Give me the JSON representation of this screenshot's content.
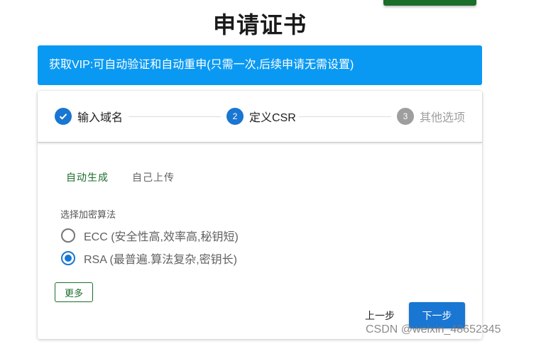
{
  "page": {
    "title": "申请证书"
  },
  "banner": {
    "text": "获取VIP:可自动验证和自动重申(只需一次,后续申请无需设置)"
  },
  "stepper": {
    "steps": [
      {
        "number": "",
        "label": "输入域名",
        "state": "done"
      },
      {
        "number": "2",
        "label": "定义CSR",
        "state": "active"
      },
      {
        "number": "3",
        "label": "其他选项",
        "state": "pending"
      }
    ]
  },
  "csr": {
    "tabs": [
      {
        "label": "自动生成",
        "selected": true
      },
      {
        "label": "自己上传",
        "selected": false
      }
    ],
    "algorithm_label": "选择加密算法",
    "options": [
      {
        "label": "ECC (安全性高,效率高,秘钥短)",
        "checked": false
      },
      {
        "label": "RSA (最普遍.算法复杂,密钥长)",
        "checked": true
      }
    ],
    "more_label": "更多"
  },
  "actions": {
    "prev_label": "上一步",
    "next_label": "下一步"
  },
  "watermark": {
    "text": "CSDN @weixin_48652345"
  },
  "colors": {
    "primary": "#1976d2",
    "banner": "#0a99f2",
    "accent_green": "#1b6d2a",
    "pending": "#9e9e9e"
  },
  "icons": {
    "done_step": "check-icon"
  }
}
